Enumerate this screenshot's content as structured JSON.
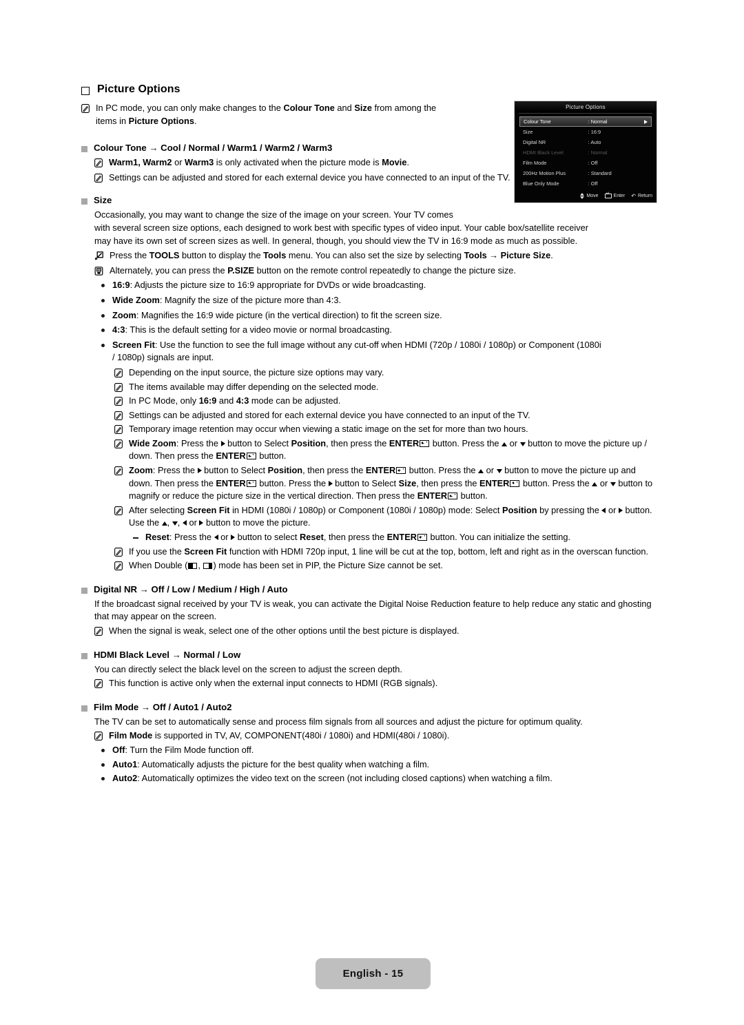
{
  "page": {
    "footer_label": "English - 15",
    "heading": "Picture Options"
  },
  "osd": {
    "title": "Picture Options",
    "rows": [
      {
        "label": "Colour Tone",
        "value": ": Normal",
        "selected": true,
        "dimmed": false
      },
      {
        "label": "Size",
        "value": ": 16:9",
        "selected": false,
        "dimmed": false
      },
      {
        "label": "Digital NR",
        "value": ": Auto",
        "selected": false,
        "dimmed": false
      },
      {
        "label": "HDMI Black Level",
        "value": ": Normal",
        "selected": false,
        "dimmed": true
      },
      {
        "label": "Film Mode",
        "value": ": Off",
        "selected": false,
        "dimmed": false
      },
      {
        "label": "200Hz Motion Plus",
        "value": ": Standard",
        "selected": false,
        "dimmed": false
      },
      {
        "label": "Blue Only Mode",
        "value": ": Off",
        "selected": false,
        "dimmed": false
      }
    ],
    "footer": {
      "move": "Move",
      "enter": "Enter",
      "return": "Return"
    }
  },
  "intro_note": {
    "line1_a": "In PC mode, you can only make changes to the ",
    "line1_b": "Colour Tone",
    "line1_c": " and ",
    "line1_d": "Size",
    "line1_e": " from among the",
    "line2_a": "items in ",
    "line2_b": "Picture Options",
    "line2_c": "."
  },
  "colour_tone": {
    "heading": "Colour Tone → Cool / Normal / Warm1 / Warm2 / Warm3",
    "note1_a": "Warm1, Warm2",
    "note1_b": " or ",
    "note1_c": "Warm3",
    "note1_d": " is only activated when the picture mode is ",
    "note1_e": "Movie",
    "note1_f": ".",
    "note2": "Settings can be adjusted and stored for each external device you have connected to an input of the TV."
  },
  "size": {
    "heading": "Size",
    "para_l1": "Occasionally, you may want to change the size of the image on your screen. Your TV comes",
    "para_l2": "with several screen size options, each designed to work best with specific types of video input. Your cable box/satellite receiver",
    "para_l3": "may have its own set of screen sizes as well. In general, though, you should view the TV in 16:9 mode as much as possible.",
    "tools_a": "Press the ",
    "tools_b": "TOOLS",
    "tools_c": " button to display the ",
    "tools_d": "Tools",
    "tools_e": " menu. You can also set the size by selecting ",
    "tools_f": "Tools → Picture Size",
    "tools_g": ".",
    "psize_a": "Alternately, you can press the ",
    "psize_b": "P.SIZE",
    "psize_c": " button on the remote control repeatedly to change the picture size.",
    "options": [
      {
        "term": "16:9",
        "desc": ": Adjusts the picture size to 16:9 appropriate for DVDs or wide broadcasting."
      },
      {
        "term": "Wide Zoom",
        "desc": ": Magnify the size of the picture more than 4:3."
      },
      {
        "term": "Zoom",
        "desc": ": Magnifies the 16:9 wide picture (in the vertical direction) to fit the screen size."
      },
      {
        "term": "4:3",
        "desc": ": This is the default setting for a video movie or normal broadcasting."
      }
    ],
    "screenfit_term": "Screen Fit",
    "screenfit_l1": ": Use the function to see the full image without any cut-off when HDMI (720p / 1080i / 1080p) or Component (1080i",
    "screenfit_l2": "/ 1080p) signals are input.",
    "notes": {
      "n1": "Depending on the input source, the picture size options may vary.",
      "n2": "The items available may differ depending on the selected mode.",
      "n3_a": "In PC Mode, only ",
      "n3_b": "16:9",
      "n3_c": " and ",
      "n3_d": "4:3",
      "n3_e": " mode can be adjusted.",
      "n4": "Settings can be adjusted and stored for each external device you have connected to an input of the TV.",
      "n5": "Temporary image retention may occur when viewing a static image on the set for more than two hours.",
      "widezoom_term": "Wide Zoom",
      "widezoom_p1": ": Press the ",
      "widezoom_p2": " button to Select ",
      "widezoom_p3": "Position",
      "widezoom_p4": ", then press the ",
      "widezoom_p5": "ENTER",
      "widezoom_p6": " button. Press the ",
      "widezoom_p7": " or ",
      "widezoom_p8": " button to move the picture up / down. Then press the ",
      "widezoom_p9": " button.",
      "zoom_term": "Zoom",
      "zoom_p1": ": Press the ",
      "zoom_p2": " button to Select ",
      "zoom_p3": "Position",
      "zoom_p4": ", then press the ",
      "zoom_p5": " button. Press the ",
      "zoom_p6": " or ",
      "zoom_p7": " button to move the picture up and down. Then press the ",
      "zoom_p8": " button. Press the ",
      "zoom_p9": " button to Select ",
      "zoom_p10": "Size",
      "zoom_p11": ", then press the ",
      "zoom_p12": " button. Press the ",
      "zoom_p13": " or ",
      "zoom_p14": " button to magnify or reduce the picture size in the vertical direction. Then press the ",
      "zoom_p15": " button.",
      "sf_a": "After selecting ",
      "sf_b": "Screen Fit",
      "sf_c": " in HDMI (1080i / 1080p) or Component (1080i / 1080p) mode: Select ",
      "sf_d": "Position",
      "sf_e": " by pressing the ",
      "sf_f": " or ",
      "sf_g": " button. Use the ",
      "sf_h": ", ",
      "sf_i": ", ",
      "sf_j": " or ",
      "sf_k": " button to move the picture.",
      "reset_term": "Reset",
      "reset_a": ": Press the ",
      "reset_b": " or ",
      "reset_c": " button to select ",
      "reset_d": "Reset",
      "reset_e": ", then press the ",
      "reset_f": "ENTER",
      "reset_g": " button. You can initialize the setting.",
      "overscan_a": "If you use the ",
      "overscan_b": "Screen Fit",
      "overscan_c": " function with HDMI 720p input, 1 line will be cut at the top, bottom, left and right as in the overscan function.",
      "double_a": "When Double (",
      "double_b": ", ",
      "double_c": ") mode has been set in PIP, the Picture Size cannot be set."
    }
  },
  "digital_nr": {
    "heading": "Digital NR → Off / Low / Medium / High / Auto",
    "para": "If the broadcast signal received by your TV is weak, you can activate the Digital Noise Reduction feature to help reduce any static and ghosting that may appear on the screen.",
    "note": "When the signal is weak, select one of the other options until the best picture is displayed."
  },
  "hdmi_black_level": {
    "heading": "HDMI Black Level → Normal / Low",
    "para": "You can directly select the black level on the screen to adjust the screen depth.",
    "note": "This function is active only when the external input connects to HDMI (RGB signals)."
  },
  "film_mode": {
    "heading": "Film Mode → Off / Auto1 / Auto2",
    "para": "The TV can be set to automatically sense and process film signals from all sources and adjust the picture for optimum quality.",
    "note_a": "Film Mode",
    "note_b": " is supported in TV, AV, COMPONENT(480i / 1080i) and HDMI(480i / 1080i).",
    "options": [
      {
        "term": "Off",
        "desc": ": Turn the Film Mode function off."
      },
      {
        "term": "Auto1",
        "desc": ": Automatically adjusts the picture for the best quality when watching a film."
      },
      {
        "term": "Auto2",
        "desc": ": Automatically optimizes the video text on the screen (not including closed captions) when watching a film."
      }
    ]
  }
}
